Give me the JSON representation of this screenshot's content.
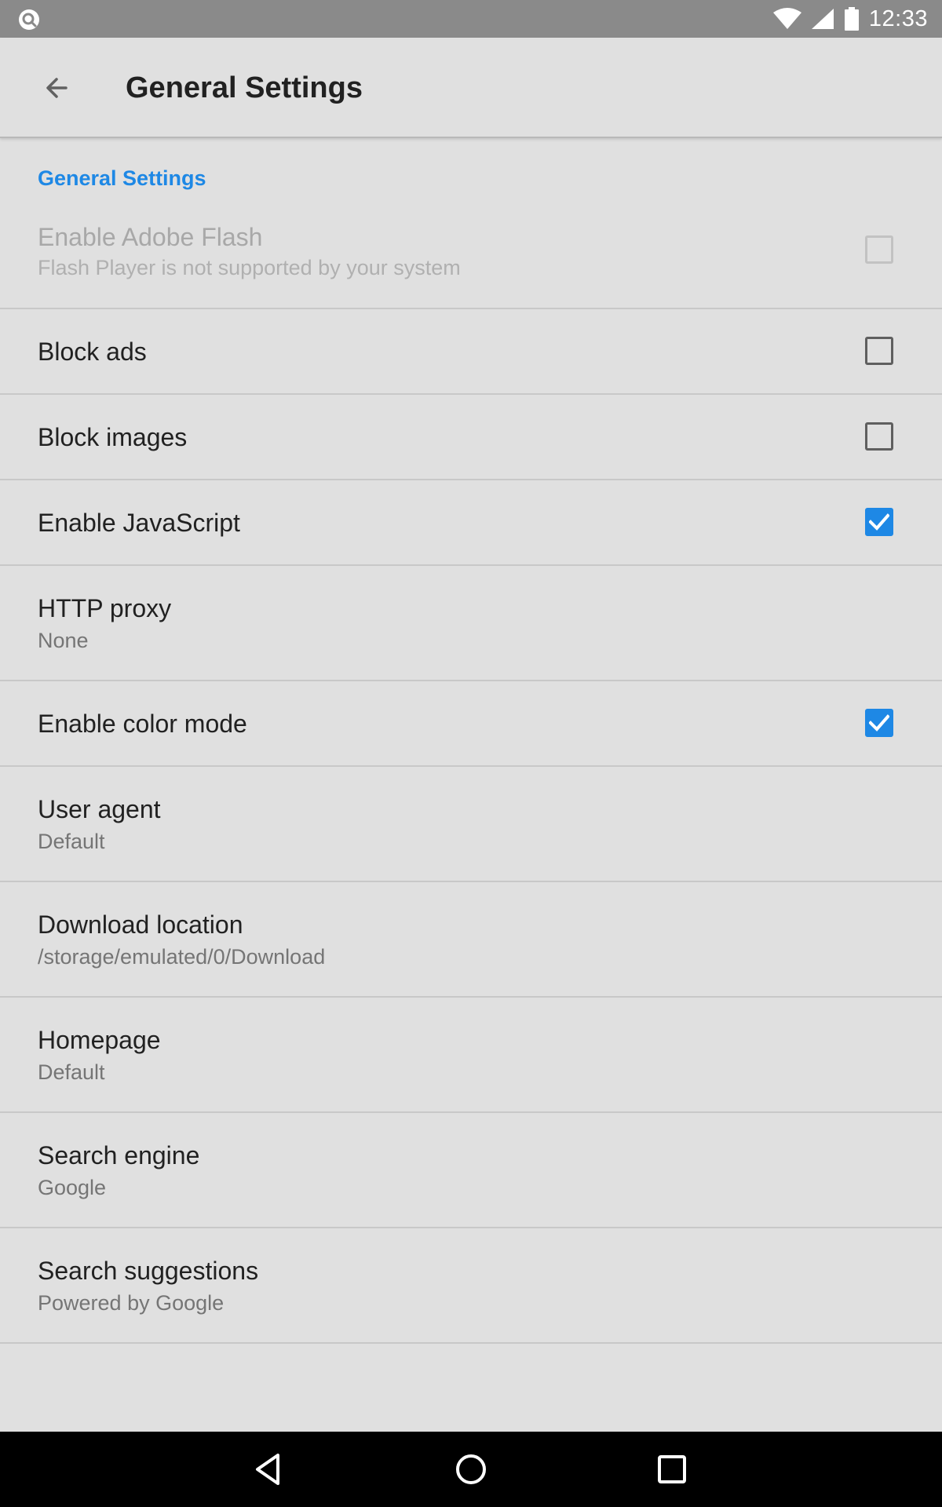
{
  "status_bar": {
    "time": "12:33"
  },
  "app_bar": {
    "title": "General Settings"
  },
  "section_header": "General Settings",
  "preferences": {
    "flash": {
      "title": "Enable Adobe Flash",
      "summary": "Flash Player is not supported by your system",
      "checked": false,
      "enabled": false
    },
    "block_ads": {
      "title": "Block ads",
      "checked": false
    },
    "block_images": {
      "title": "Block images",
      "checked": false
    },
    "javascript": {
      "title": "Enable JavaScript",
      "checked": true
    },
    "http_proxy": {
      "title": "HTTP proxy",
      "summary": "None"
    },
    "color_mode": {
      "title": "Enable color mode",
      "checked": true
    },
    "user_agent": {
      "title": "User agent",
      "summary": "Default"
    },
    "download_location": {
      "title": "Download location",
      "summary": "/storage/emulated/0/Download"
    },
    "homepage": {
      "title": "Homepage",
      "summary": "Default"
    },
    "search_engine": {
      "title": "Search engine",
      "summary": "Google"
    },
    "search_suggestions": {
      "title": "Search suggestions",
      "summary": "Powered by Google"
    }
  },
  "colors": {
    "accent": "#1e88e5",
    "background": "#e0e0e0",
    "status_bar": "#8a8a8a",
    "nav_bar": "#000000"
  },
  "icons": {
    "status_left": "search-notification-icon",
    "wifi": "wifi-icon",
    "cellular": "cellular-signal-icon",
    "battery": "battery-icon",
    "back": "arrow-back-icon",
    "nav_back": "nav-back-triangle-icon",
    "nav_home": "nav-home-circle-icon",
    "nav_recents": "nav-recents-square-icon"
  }
}
